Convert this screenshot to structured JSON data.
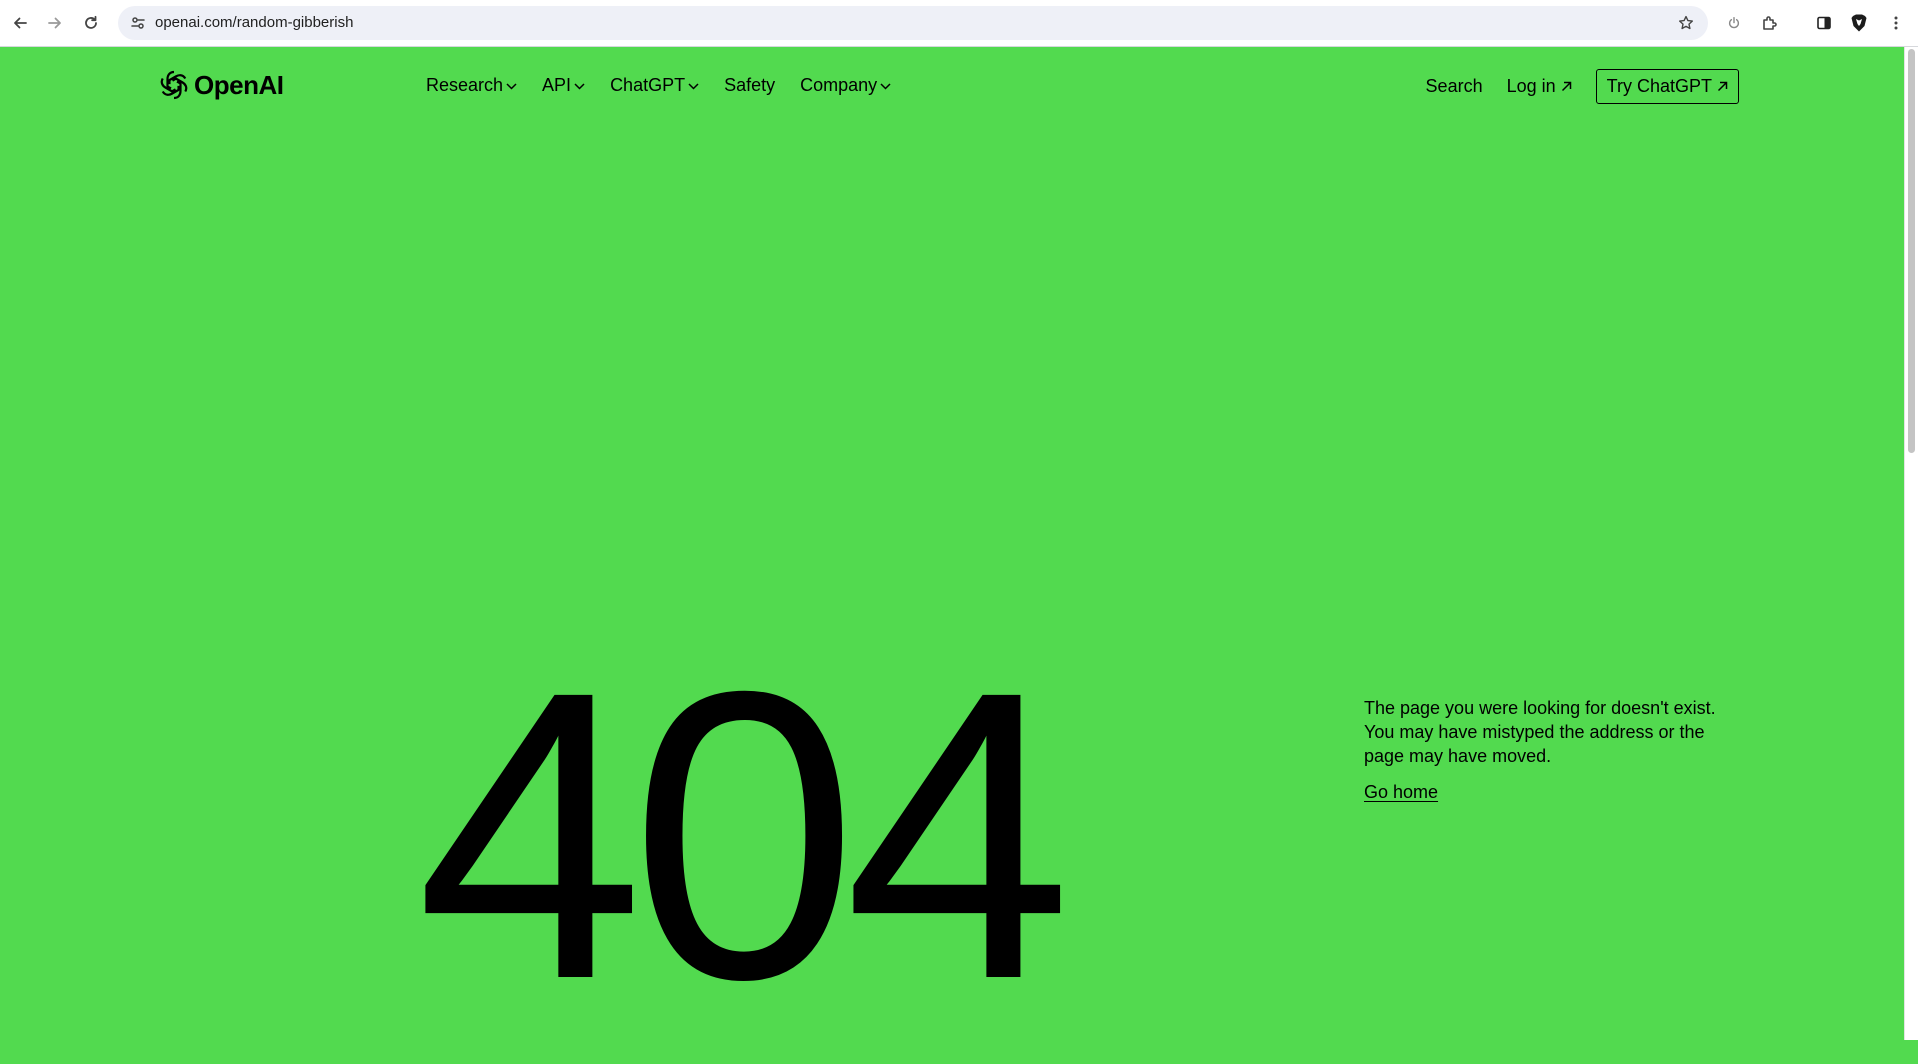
{
  "browser": {
    "url": "openai.com/random-gibberish",
    "icons": [
      "back-icon",
      "forward-icon",
      "reload-icon",
      "site-info-icon",
      "bookmark-star-icon",
      "power-icon",
      "extensions-icon",
      "side-panel-icon",
      "shield-icon",
      "more-menu-icon"
    ]
  },
  "header": {
    "logo_text": "OpenAI",
    "nav": [
      {
        "label": "Research",
        "has_dropdown": true
      },
      {
        "label": "API",
        "has_dropdown": true
      },
      {
        "label": "ChatGPT",
        "has_dropdown": true
      },
      {
        "label": "Safety",
        "has_dropdown": false
      },
      {
        "label": "Company",
        "has_dropdown": true
      }
    ],
    "search_label": "Search",
    "login_label": "Log in",
    "try_label": "Try ChatGPT"
  },
  "error": {
    "code": "404",
    "message": "The page you were looking for doesn't exist. You may have mistyped the address or the page may have moved.",
    "go_home_label": "Go home"
  },
  "colors": {
    "page_background": "#52DA4F",
    "text": "#000000",
    "browser_bar": "#FFFFFF",
    "omnibox": "#EEF0F7"
  }
}
